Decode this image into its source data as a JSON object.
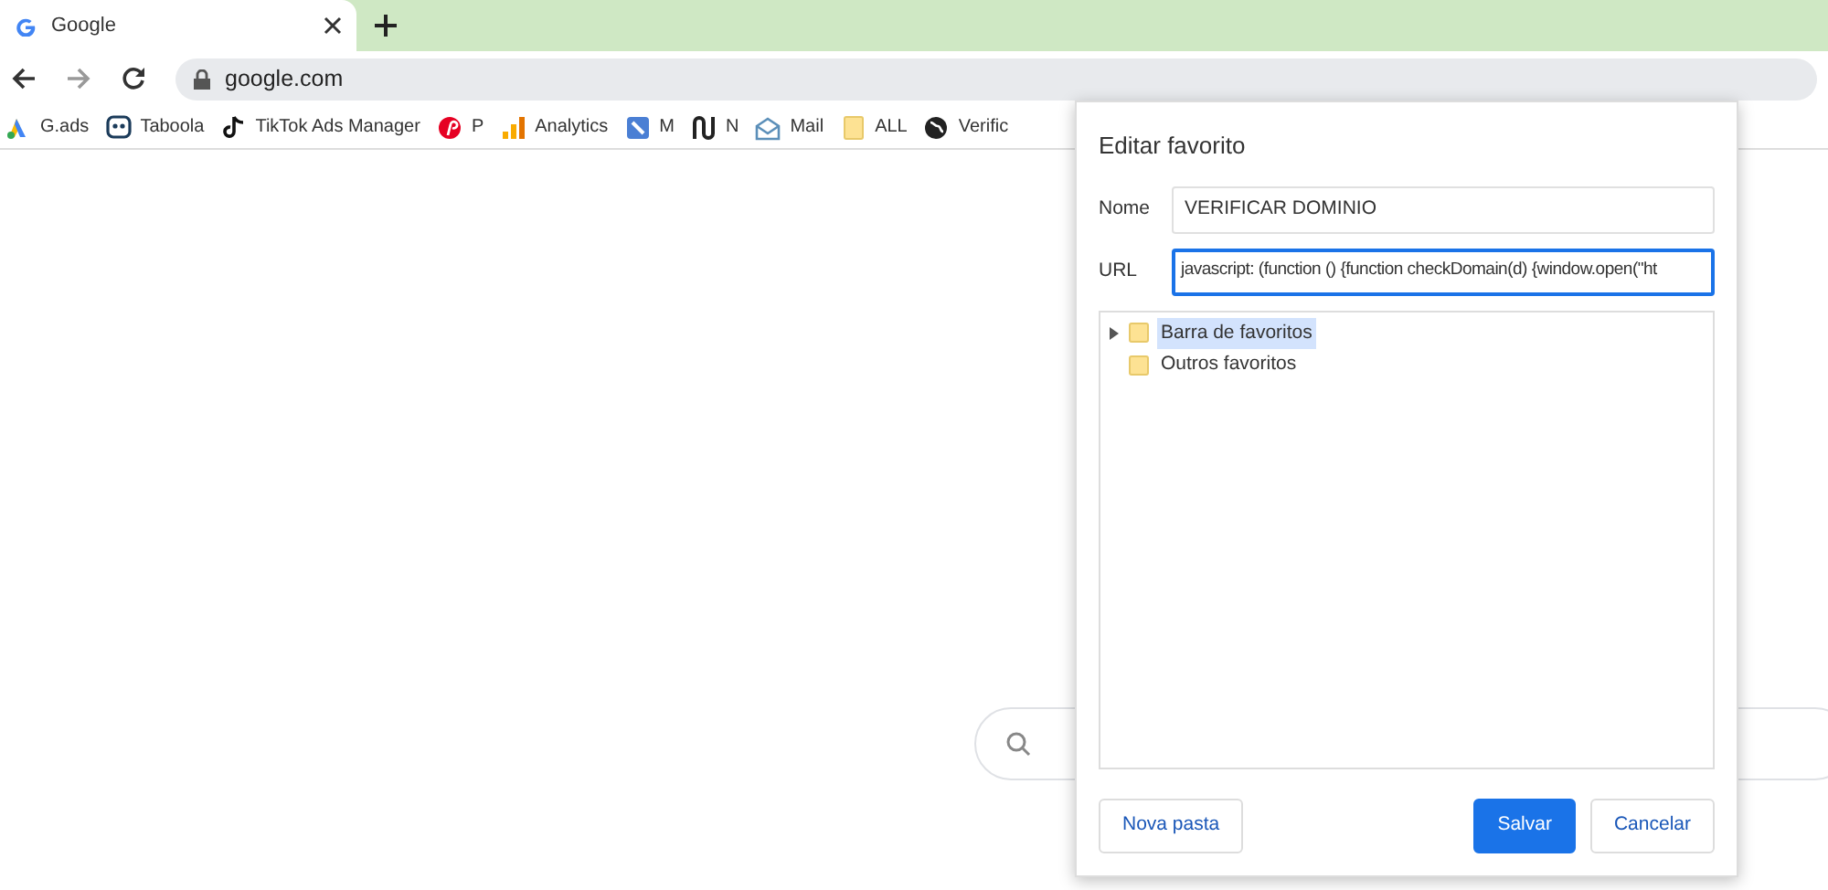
{
  "tabs": [
    {
      "title": "Google",
      "selected": true
    }
  ],
  "address_bar": {
    "url": "google.com"
  },
  "bookmarks": [
    {
      "label": "G.ads",
      "kind": "ads"
    },
    {
      "label": "Taboola",
      "kind": "robot"
    },
    {
      "label": "TikTok Ads Manager",
      "kind": "note"
    },
    {
      "label": "P",
      "kind": "pin"
    },
    {
      "label": "Analytics",
      "kind": "bars"
    },
    {
      "label": "M",
      "kind": "square"
    },
    {
      "label": "N",
      "kind": "loops"
    },
    {
      "label": "Mail",
      "kind": "mail"
    },
    {
      "label": "ALL",
      "kind": "folder"
    },
    {
      "label": "Verific",
      "kind": "globe"
    }
  ],
  "dialog": {
    "title": "Editar favorito",
    "fields": [
      {
        "label": "Nome",
        "value": "VERIFICAR DOMINIO",
        "focused": false
      },
      {
        "label": "URL",
        "value": "javascript: (function () {function checkDomain(d) {window.open(\"ht",
        "focused": true
      }
    ],
    "folders": [
      {
        "label": "Barra de favoritos",
        "selected": true,
        "expanded": false,
        "has_children": true
      },
      {
        "label": "Outros favoritos",
        "selected": false,
        "expanded": false,
        "has_children": false
      }
    ],
    "buttons": [
      {
        "label": "Nova pasta",
        "kind": "secondary"
      },
      {
        "label": "Salvar",
        "kind": "primary"
      },
      {
        "label": "Cancelar",
        "kind": "secondary"
      }
    ]
  }
}
